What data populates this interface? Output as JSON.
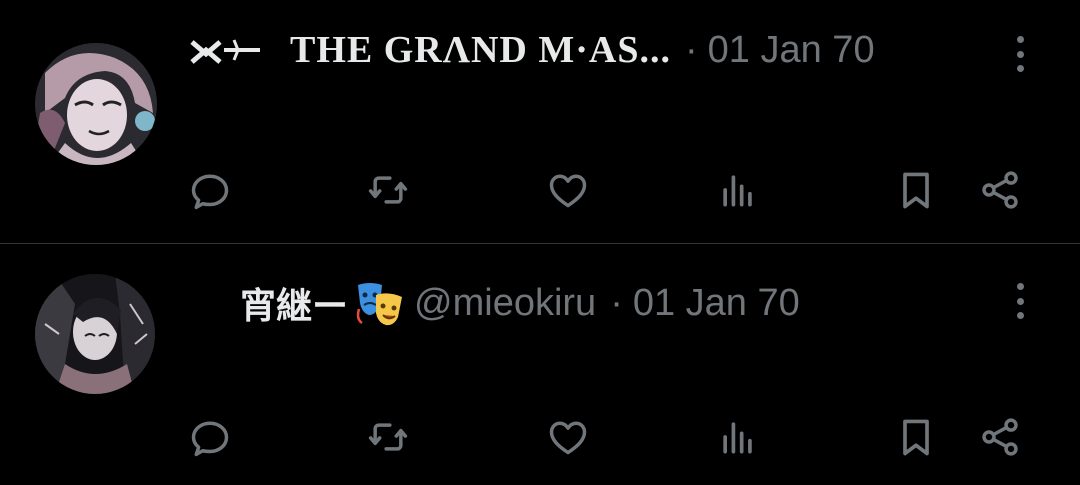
{
  "theme": {
    "background": "#000000",
    "text": "#e7e9ea",
    "muted": "#71767b",
    "divider": "#2f3336"
  },
  "tweets": [
    {
      "display_name": "THE GRΛND    M·AS...",
      "separator": "·",
      "date": "01 Jan 70",
      "icons": [
        "reply-icon",
        "retweet-icon",
        "like-icon",
        "views-icon",
        "bookmark-icon",
        "share-icon"
      ]
    },
    {
      "display_name": "宵継ー",
      "name_emoji": "performing-arts-emoji",
      "handle": "@mieokiru",
      "separator": "·",
      "date": "01 Jan 70",
      "icons": [
        "reply-icon",
        "retweet-icon",
        "like-icon",
        "views-icon",
        "bookmark-icon",
        "share-icon"
      ]
    }
  ]
}
